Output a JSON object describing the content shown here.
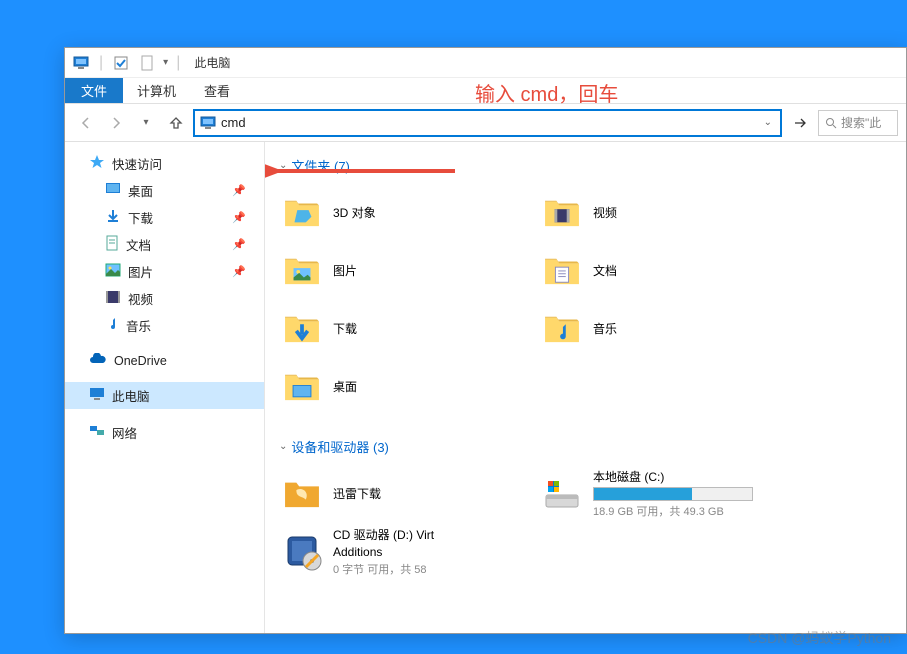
{
  "titlebar": {
    "title": "此电脑"
  },
  "ribbon": {
    "file": "文件",
    "tabs": [
      "计算机",
      "查看"
    ]
  },
  "annotation_text": "输入 cmd，回车",
  "address": {
    "value": "cmd"
  },
  "search": {
    "placeholder": "搜索\"此"
  },
  "sidebar": {
    "quick_access": "快速访问",
    "qa_items": [
      {
        "label": "桌面"
      },
      {
        "label": "下载"
      },
      {
        "label": "文档"
      },
      {
        "label": "图片"
      },
      {
        "label": "视频"
      },
      {
        "label": "音乐"
      }
    ],
    "onedrive": "OneDrive",
    "this_pc": "此电脑",
    "network": "网络"
  },
  "content": {
    "folders_header": "文件夹 (7)",
    "devices_header": "设备和驱动器 (3)",
    "folders": [
      {
        "label": "3D 对象"
      },
      {
        "label": "视频"
      },
      {
        "label": "图片"
      },
      {
        "label": "文档"
      },
      {
        "label": "下载"
      },
      {
        "label": "音乐"
      },
      {
        "label": "桌面"
      }
    ],
    "devices": [
      {
        "label": "迅雷下载",
        "type": "folder"
      },
      {
        "label": "本地磁盘 (C:)",
        "sub": "18.9 GB 可用，共 49.3 GB",
        "type": "disk",
        "used_pct": 62
      },
      {
        "label": "CD 驱动器 (D:) VirtualBox Guest Additions",
        "label_short": "CD 驱动器 (D:) Virt",
        "sub2": "Additions",
        "sub": "0 字节 可用，共 58",
        "type": "cd"
      }
    ]
  },
  "watermark": "CSDN @蚂蚁学Python"
}
